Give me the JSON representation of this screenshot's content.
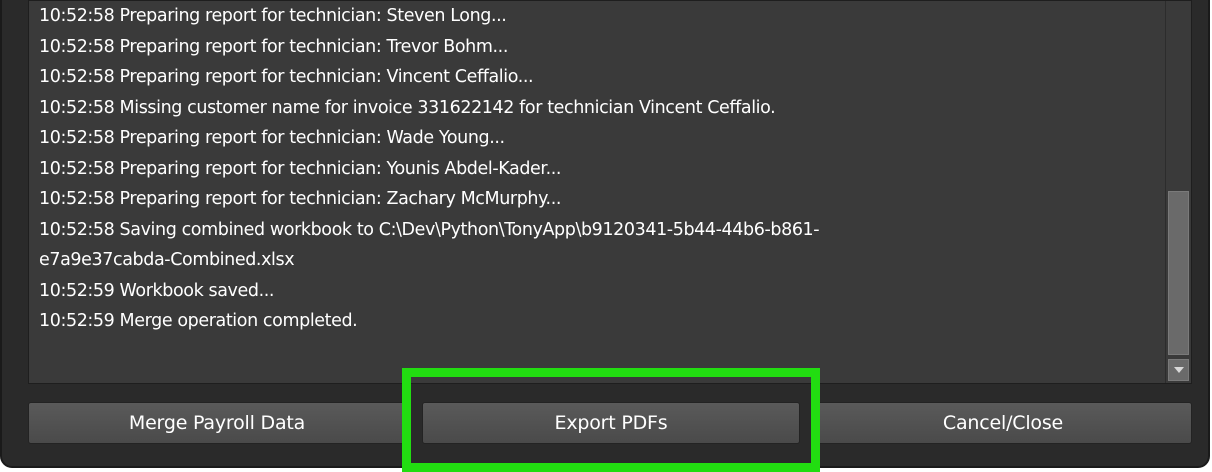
{
  "log": {
    "lines": [
      "10:52:58 Preparing report for technician: Steven Long...",
      "10:52:58 Preparing report for technician: Trevor Bohm...",
      "10:52:58 Preparing report for technician: Vincent Ceffalio...",
      "10:52:58 Missing customer name for invoice 331622142 for technician Vincent Ceffalio.",
      "10:52:58 Preparing report for technician: Wade Young...",
      "10:52:58 Preparing report for technician: Younis Abdel-Kader...",
      "10:52:58 Preparing report for technician: Zachary McMurphy...",
      "10:52:58 Saving combined workbook to C:\\Dev\\Python\\TonyApp\\b9120341-5b44-44b6-b861-",
      "e7a9e37cabda-Combined.xlsx",
      "10:52:59 Workbook saved...",
      "10:52:59 Merge operation completed."
    ]
  },
  "buttons": {
    "merge_label": "Merge Payroll Data",
    "export_label": "Export PDFs",
    "cancel_label": "Cancel/Close"
  },
  "colors": {
    "window_bg": "#2a2a2a",
    "log_bg": "#3a3a3a",
    "button_bg": "#525252",
    "highlight": "#22dd11",
    "text": "#ffffff"
  }
}
